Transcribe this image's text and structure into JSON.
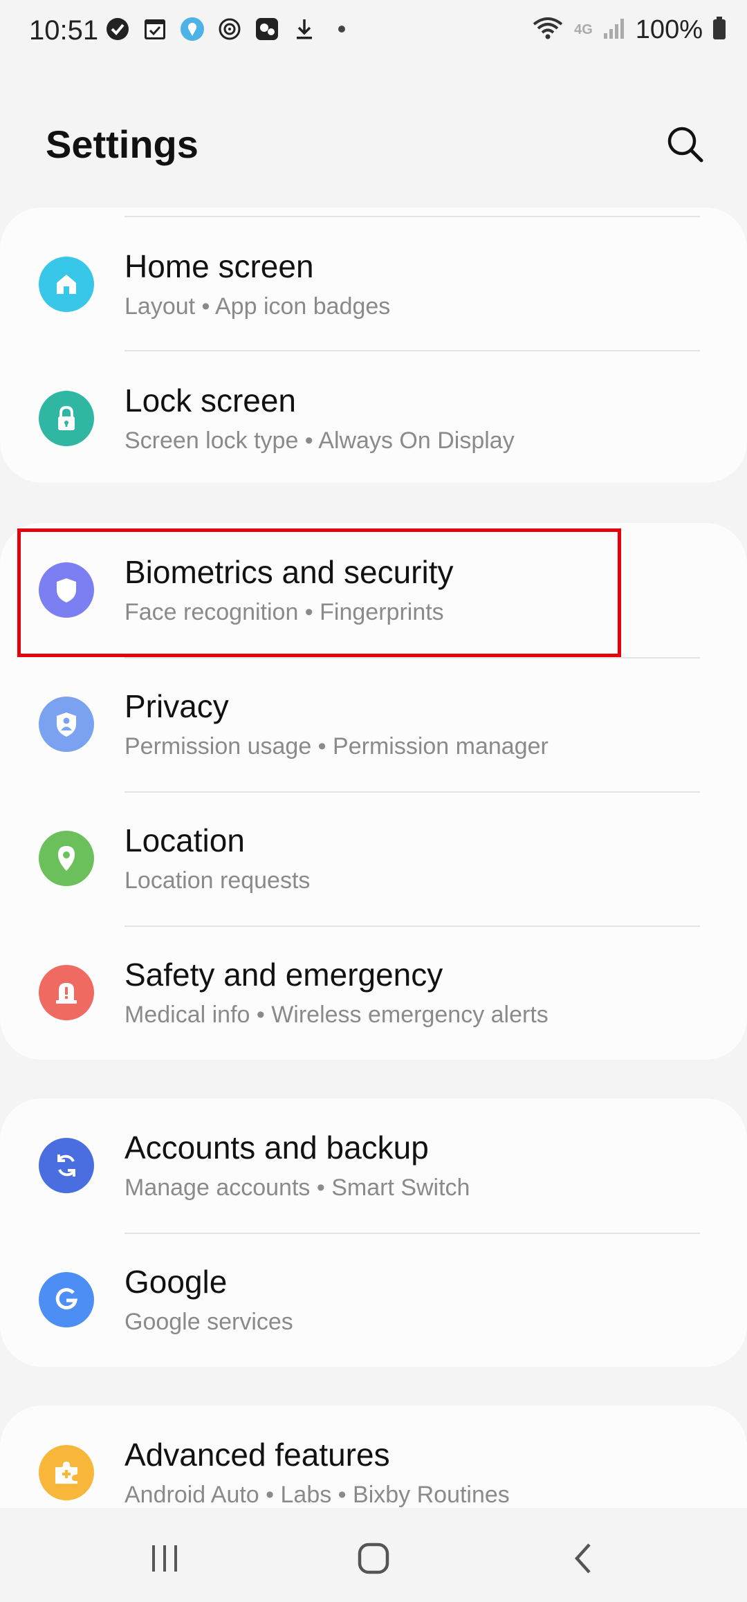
{
  "status_bar": {
    "time": "10:51",
    "battery": "100%",
    "network": "4G"
  },
  "header": {
    "title": "Settings"
  },
  "items": [
    {
      "title": "Home screen",
      "subtitle": "Layout  •  App icon badges",
      "icon": "home-icon",
      "color": "#38c7e8"
    },
    {
      "title": "Lock screen",
      "subtitle": "Screen lock type  •  Always On Display",
      "icon": "lock-icon",
      "color": "#2fb7a3"
    },
    {
      "title": "Biometrics and security",
      "subtitle": "Face recognition  •  Fingerprints",
      "icon": "shield-icon",
      "color": "#7b7ff2"
    },
    {
      "title": "Privacy",
      "subtitle": "Permission usage  •  Permission manager",
      "icon": "privacy-shield-icon",
      "color": "#7aa2f0"
    },
    {
      "title": "Location",
      "subtitle": "Location requests",
      "icon": "location-pin-icon",
      "color": "#6cc05b"
    },
    {
      "title": "Safety and emergency",
      "subtitle": "Medical info  •  Wireless emergency alerts",
      "icon": "siren-icon",
      "color": "#ef6b62"
    },
    {
      "title": "Accounts and backup",
      "subtitle": "Manage accounts  •  Smart Switch",
      "icon": "sync-icon",
      "color": "#4a6ee0"
    },
    {
      "title": "Google",
      "subtitle": "Google services",
      "icon": "google-icon",
      "color": "#4d8ef5"
    },
    {
      "title": "Advanced features",
      "subtitle": "Android Auto  •  Labs  •  Bixby Routines",
      "icon": "puzzle-icon",
      "color": "#f8b73b"
    }
  ],
  "highlight_color": "#e5000b"
}
